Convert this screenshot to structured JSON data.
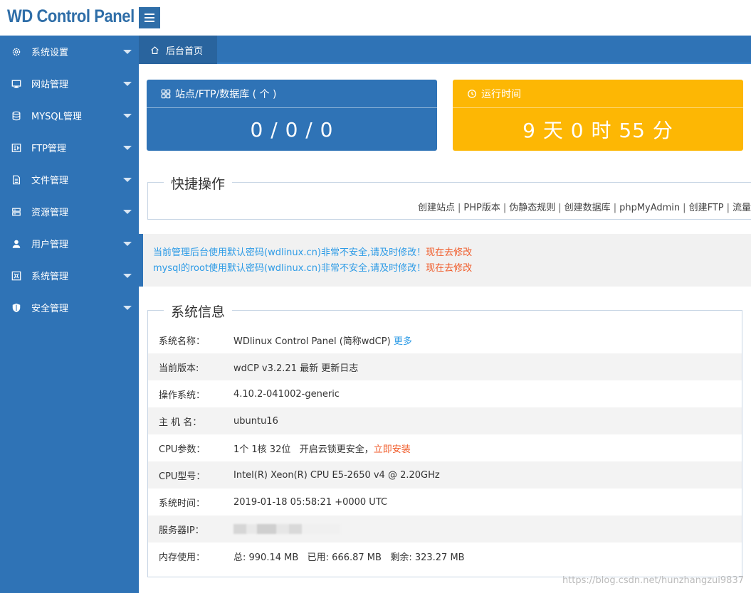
{
  "header": {
    "logo": "WD Control Panel"
  },
  "sidebar": {
    "items": [
      {
        "label": "系统设置",
        "icon": "gear-icon"
      },
      {
        "label": "网站管理",
        "icon": "monitor-icon"
      },
      {
        "label": "MYSQL管理",
        "icon": "database-icon"
      },
      {
        "label": "FTP管理",
        "icon": "ftp-icon"
      },
      {
        "label": "文件管理",
        "icon": "file-icon"
      },
      {
        "label": "资源管理",
        "icon": "server-icon"
      },
      {
        "label": "用户管理",
        "icon": "user-icon"
      },
      {
        "label": "系统管理",
        "icon": "settings-icon"
      },
      {
        "label": "安全管理",
        "icon": "shield-icon"
      }
    ]
  },
  "tabs": [
    {
      "label": "后台首页",
      "icon": "home-icon"
    }
  ],
  "cards": {
    "sites": {
      "title": "站点/FTP/数据库 ( 个 )",
      "value": "0 / 0 / 0",
      "icon": "grid-icon",
      "color": "#2f73b6"
    },
    "uptime": {
      "title": "运行时间",
      "value": "9 天 0 时 55 分",
      "icon": "clock-icon",
      "color": "#fdb704"
    }
  },
  "quick": {
    "legend": "快捷操作",
    "links": [
      "创建站点",
      "PHP版本",
      "伪静态规则",
      "创建数据库",
      "phpMyAdmin",
      "创建FTP",
      "流量"
    ]
  },
  "warnings": [
    {
      "text": "当前管理后台使用默认密码(wdlinux.cn)非常不安全,请及时修改！",
      "action": "现在去修改"
    },
    {
      "text": "mysql的root使用默认密码(wdlinux.cn)非常不安全,请及时修改！",
      "action": "现在去修改"
    }
  ],
  "sysinfo": {
    "legend": "系统信息",
    "rows": [
      {
        "key": "系统名称：",
        "value": "WDlinux Control Panel (简称wdCP)",
        "link": "更多"
      },
      {
        "key": "当前版本:",
        "value": "wdCP v3.2.21 最新 更新日志"
      },
      {
        "key": "操作系统：",
        "value": "4.10.2-041002-generic"
      },
      {
        "key": "主 机 名：",
        "value": "ubuntu16"
      },
      {
        "key": "CPU参数：",
        "value": "1个 1核 32位   开启云锁更安全，",
        "action": "立即安装"
      },
      {
        "key": "CPU型号：",
        "value": "Intel(R) Xeon(R) CPU E5-2650 v4 @ 2.20GHz"
      },
      {
        "key": "系统时间：",
        "value": "2019-01-18 05:58:21 +0000 UTC"
      },
      {
        "key": "服务器IP：",
        "value": ""
      },
      {
        "key": "内存使用：",
        "value": "总: 990.14 MB   已用: 666.87 MB   剩余: 323.27 MB"
      }
    ]
  },
  "watermark": "https://blog.csdn.net/hunzhangzui9837",
  "colors": {
    "primary": "#2f73b6",
    "accent": "#fdb704",
    "link": "#2d9be6",
    "danger": "#f05a28"
  }
}
